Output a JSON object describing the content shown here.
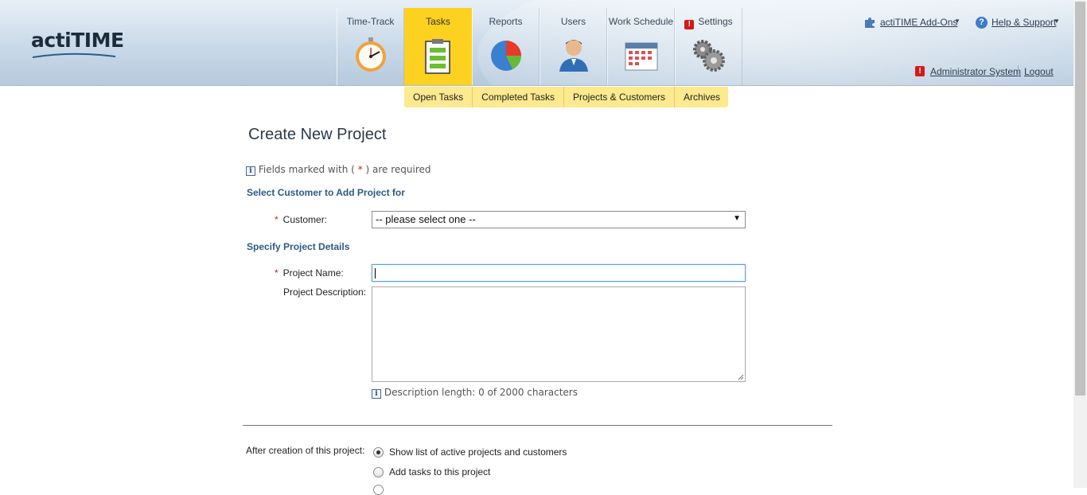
{
  "app": {
    "logo_text": "actiTIME"
  },
  "nav": {
    "tabs": [
      {
        "label": "Time-Track",
        "icon": "stopwatch-icon"
      },
      {
        "label": "Tasks",
        "icon": "clipboard-icon",
        "active": true
      },
      {
        "label": "Reports",
        "icon": "pie-chart-icon"
      },
      {
        "label": "Users",
        "icon": "user-icon"
      },
      {
        "label": "Work Schedule",
        "icon": "calendar-icon"
      },
      {
        "label": "Settings",
        "icon": "gears-icon",
        "alert": "!"
      }
    ],
    "subnav": [
      "Open Tasks",
      "Completed Tasks",
      "Projects & Customers",
      "Archives"
    ]
  },
  "top_links": {
    "addons": "actiTIME Add-Ons",
    "help": "Help & Support",
    "user": "Administrator System",
    "logout": "Logout"
  },
  "form": {
    "title": "Create New Project",
    "required_note_prefix": "Fields marked with (",
    "required_note_star": "*",
    "required_note_suffix": ") are required",
    "section_customer": "Select Customer to Add Project for",
    "customer_label": "Customer:",
    "customer_value": "-- please select one --",
    "section_details": "Specify Project Details",
    "project_name_label": "Project Name:",
    "project_name_value": "",
    "project_description_label": "Project Description:",
    "description_length": "Description length: 0 of 2000 characters",
    "after_creation_label": "After creation of this project:",
    "after_options": [
      {
        "label": "Show list of active projects and customers",
        "checked": true
      },
      {
        "label": "Add tasks to this project",
        "checked": false
      }
    ]
  },
  "colors": {
    "active_tab": "#fdd11f",
    "subnav": "#fde98e",
    "section_heading": "#2c5a84",
    "required_star": "#d21a1a"
  }
}
